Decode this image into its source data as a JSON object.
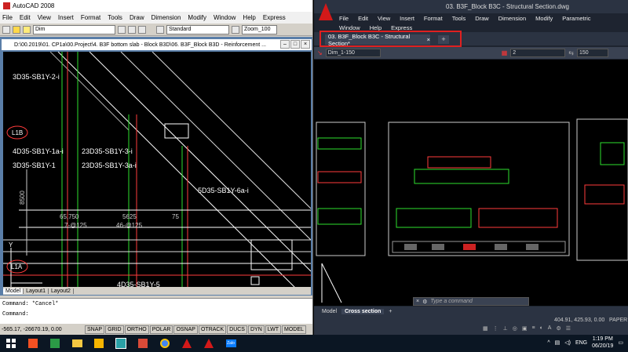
{
  "left_window": {
    "app_title": "AutoCAD 2008",
    "menu": [
      "File",
      "Edit",
      "View",
      "Insert",
      "Format",
      "Tools",
      "Draw",
      "Dimension",
      "Modify",
      "Window",
      "Help",
      "Express"
    ],
    "toolbar": {
      "layer_combo": "Dim",
      "text_style": "Standard",
      "zoom": "Zoom_100"
    },
    "doc_title": "D:\\00.2019\\01. CP1a\\00.Project\\4. B3F bottom slab - Block B3D\\06. B3F_Block B3D - Reinforcement ...",
    "drawing_labels": {
      "top": "3D35-SB1Y-2-i",
      "l1b": "L1B",
      "r1a": "4D35-SB1Y-1a-i",
      "r1b": "23D35-SB1Y-3-i",
      "r2a": "3D35-SB1Y-1",
      "r2b": "23D35-SB1Y-3a-i",
      "right_label": "5D35-SB1Y-6a-i",
      "dim_vert": "8500",
      "d1a": "65,750",
      "d1b": "7-@125",
      "d2a": "5625",
      "d2b": "46-@125",
      "d3": "75",
      "l1a": "L1A",
      "bottom": "4D35-SB1Y-5",
      "y_axis": "Y"
    },
    "layout_tabs": [
      "Model",
      "Layout1",
      "Layout2"
    ],
    "command_lines": [
      "Command: *Cancel*",
      "Command:"
    ],
    "coords": "-565.17, -26670.19, 0.00",
    "status_buttons": [
      "SNAP",
      "GRID",
      "ORTHO",
      "POLAR",
      "OSNAP",
      "OTRACK",
      "DUCS",
      "DYN",
      "LWT",
      "MODEL"
    ]
  },
  "right_window": {
    "title": "03. B3F_Block B3C - Structural Section.dwg",
    "menu_row1": [
      "File",
      "Edit",
      "View",
      "Insert",
      "Format",
      "Tools",
      "Draw",
      "Dimension",
      "Modify",
      "Parametric"
    ],
    "menu_row2": [
      "Window",
      "Help",
      "Express"
    ],
    "doc_tab": "03. B3F_Block B3C - Structural Section*",
    "tab_close": "×",
    "plus": "+",
    "toolbar": {
      "dim_style": "Dim_1-150",
      "value1": "2",
      "value2": "150"
    },
    "command_placeholder": "Type a command",
    "model_tabs": [
      "Model",
      "Cross section"
    ],
    "coords": "404.91, 425.93, 0.00",
    "paper": "PAPER"
  },
  "taskbar": {
    "lang": "ENG",
    "time": "1:19 PM",
    "date": "06/20/19"
  },
  "colors": {
    "highlight_red": "#e02020",
    "cad_black": "#000000",
    "text_white": "#ffffff"
  }
}
